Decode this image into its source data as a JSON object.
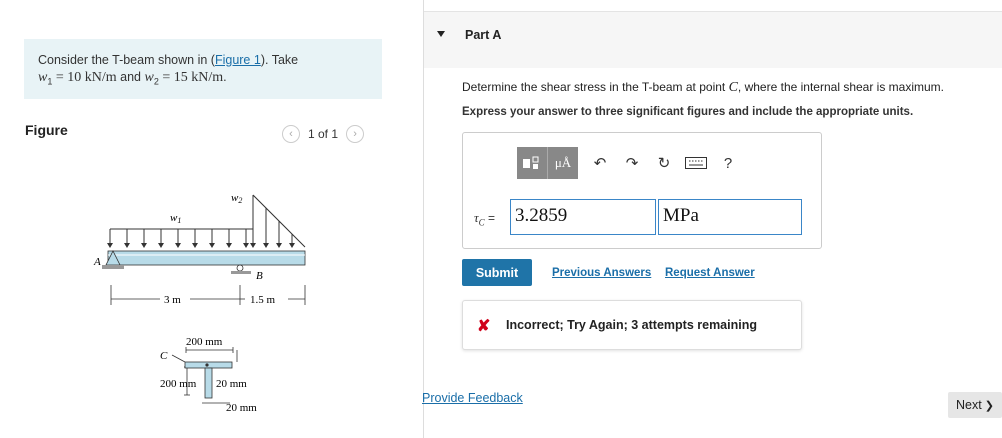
{
  "problem": {
    "line1_prefix": "Consider the T-beam shown in (",
    "figure_link": "Figure 1",
    "line1_suffix": "). Take",
    "w1_sym": "w",
    "w1_sub": "1",
    "w1_val": " = 10 kN/m",
    "and": " and ",
    "w2_sym": "w",
    "w2_sub": "2",
    "w2_val": " = 15 kN/m",
    "end": "."
  },
  "figure": {
    "label": "Figure",
    "pager_text": "1 of 1",
    "w1": "w",
    "w1_sub": "1",
    "w2": "w",
    "w2_sub": "2",
    "pt_a": "A",
    "pt_b": "B",
    "pt_c": "C",
    "dim_3m": "3 m",
    "dim_15m": "1.5 m",
    "dim_200_top": "200 mm",
    "dim_200_left": "200 mm",
    "dim_20_web": "20 mm",
    "dim_20_bottom": "20 mm"
  },
  "part": {
    "title": "Part A",
    "question_prefix": "Determine the shear stress in the T-beam at point ",
    "question_point": "C",
    "question_suffix": ", where the internal shear is maximum.",
    "instruction": "Express your answer to three significant figures and include the appropriate units.",
    "tau_sym": "τ",
    "tau_sub": "C",
    "tau_eq": " =",
    "value": "3.2859",
    "unit": "MPa",
    "units_btn": "μÅ",
    "help_icon": "?"
  },
  "actions": {
    "submit": "Submit",
    "previous_answers": "Previous Answers",
    "request_answer": "Request Answer"
  },
  "feedback": {
    "text": "Incorrect; Try Again; 3 attempts remaining",
    "icon": "✘"
  },
  "footer": {
    "provide_feedback": "Provide Feedback",
    "next": "Next",
    "next_icon": "❯"
  },
  "colors": {
    "accent": "#1f74a8",
    "link": "#1a6ea8",
    "error": "#d0021b",
    "beam": "#b8dbe8",
    "problem_bg": "#e8f3f6"
  }
}
